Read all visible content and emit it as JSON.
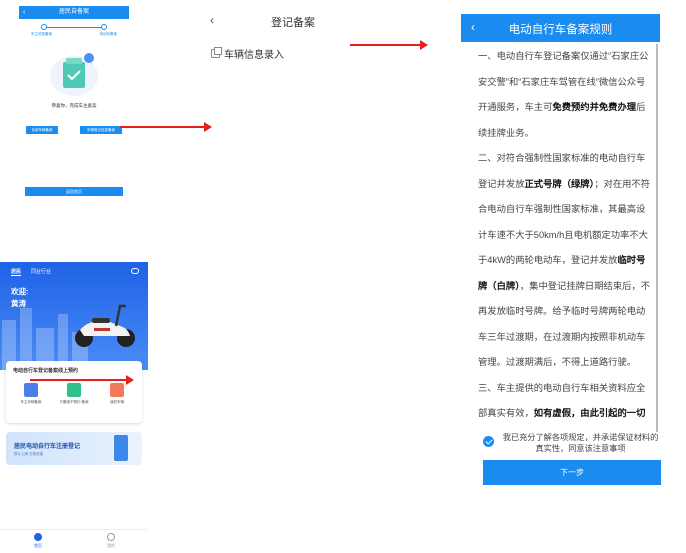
{
  "panel1": {
    "header_title": "居民自备案",
    "back": "‹",
    "step1": "车主信息备案",
    "step2": "电动车备案",
    "message": "恭喜你，完成车主备案",
    "btn_left": "自用车辆备案",
    "btn_right": "车辆登记信息备案",
    "btn_home": "返回首页"
  },
  "panel2": {
    "back": "‹",
    "title": "登记备案",
    "row_label": "车辆信息录入"
  },
  "panel3": {
    "tab_resident": "居民",
    "tab_other": "同业行业",
    "greeting": "欢迎:",
    "user_name": "黄涛",
    "card_title": "电动自行车登记备案线上预约",
    "items": [
      {
        "label": "车主车辆备案"
      },
      {
        "label": "只备案不预约 备案"
      },
      {
        "label": "我的车辆"
      }
    ],
    "banner_title": "居民电动自行车注册登记",
    "banner_sub": "群众上牌 方便快捷",
    "tab_home": "首页",
    "tab_mine": "我的"
  },
  "panel4": {
    "back": "‹",
    "title": "电动自行车备案规则",
    "rule1_a": "一、电动自行车登记备案仅通过“石家庄公安交警”和“石家庄车驾管在线”微信公众号开通服务，车主可",
    "rule1_b": "免费预约并免费办理",
    "rule1_c": "后续挂牌业务。",
    "rule2_a": "二、对符合强制性国家标准的电动自行车登记并发放",
    "rule2_b": "正式号牌（绿牌）",
    "rule2_c": "；对在用不符合电动自行车强制性国家标准，其最高设计车速不大于50km/h且电机额定功率不大于4kW的两轮电动车，登记并发放",
    "rule2_d": "临时号牌（白牌）",
    "rule2_e": "，集中登记挂牌日期结束后，不再发放临时号牌。给予临时号牌两轮电动车三年过渡期，在过渡期内按照非机动车管理。过渡期满后，不得上道路行驶。",
    "rule3_a": "三、车主提供的电动自行车相关资料应全部真实有效，",
    "rule3_b": "如有虚假，由此引起的一切",
    "agree_text": "我已充分了解各项规定，并承诺保证材料的真实性，同意该注意事项",
    "next_button": "下一步"
  },
  "colors": {
    "primary": "#1a8cf0",
    "hero": "#1f62e6",
    "arrow": "#e8201a"
  }
}
